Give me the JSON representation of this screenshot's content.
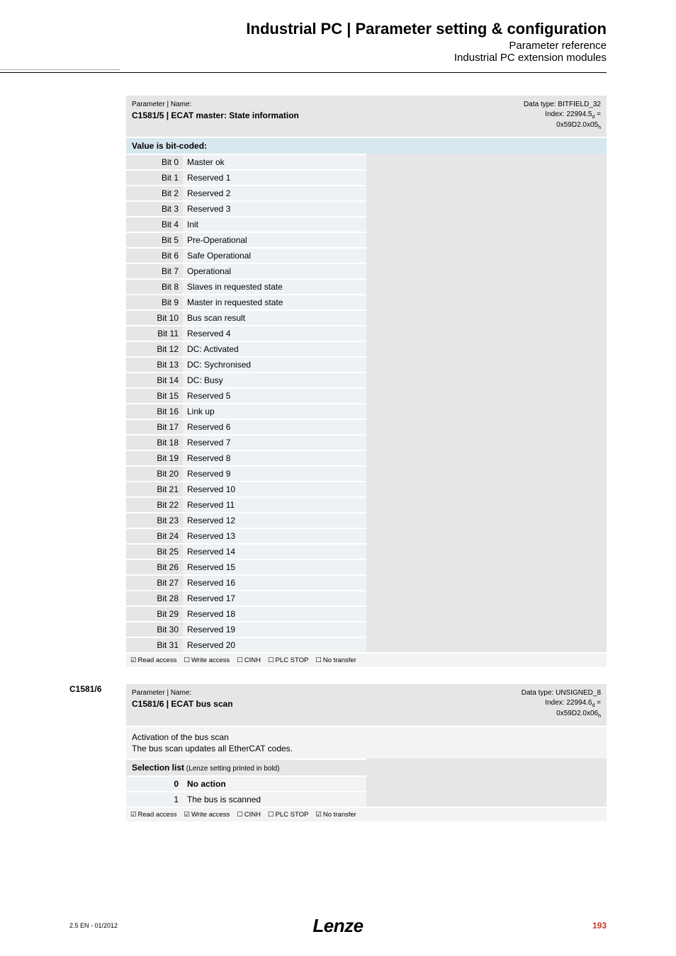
{
  "header": {
    "title": "Industrial PC | Parameter setting & configuration",
    "sub1": "Parameter reference",
    "sub2": "Industrial PC extension modules"
  },
  "param1": {
    "label": "Parameter | Name:",
    "name": "C1581/5 | ECAT master: State information",
    "datatype": "Data type: BITFIELD_32",
    "index_line": "Index: 22994.5",
    "index_sub": "d",
    "index_eq": " =",
    "hex": "0x59D2.0x05",
    "hex_sub": "h",
    "bitcoded_label": "Value is bit-coded:",
    "bits": [
      {
        "bit": "Bit 0",
        "desc": "Master ok"
      },
      {
        "bit": "Bit 1",
        "desc": "Reserved 1"
      },
      {
        "bit": "Bit 2",
        "desc": "Reserved 2"
      },
      {
        "bit": "Bit 3",
        "desc": "Reserved 3"
      },
      {
        "bit": "Bit 4",
        "desc": "Init"
      },
      {
        "bit": "Bit 5",
        "desc": "Pre-Operational"
      },
      {
        "bit": "Bit 6",
        "desc": "Safe Operational"
      },
      {
        "bit": "Bit 7",
        "desc": "Operational"
      },
      {
        "bit": "Bit 8",
        "desc": "Slaves in requested state"
      },
      {
        "bit": "Bit 9",
        "desc": "Master in requested state"
      },
      {
        "bit": "Bit 10",
        "desc": "Bus scan result"
      },
      {
        "bit": "Bit 11",
        "desc": "Reserved 4"
      },
      {
        "bit": "Bit 12",
        "desc": "DC: Activated"
      },
      {
        "bit": "Bit 13",
        "desc": "DC: Sychronised"
      },
      {
        "bit": "Bit 14",
        "desc": "DC: Busy"
      },
      {
        "bit": "Bit 15",
        "desc": "Reserved 5"
      },
      {
        "bit": "Bit 16",
        "desc": "Link up"
      },
      {
        "bit": "Bit 17",
        "desc": "Reserved 6"
      },
      {
        "bit": "Bit 18",
        "desc": "Reserved 7"
      },
      {
        "bit": "Bit 19",
        "desc": "Reserved 8"
      },
      {
        "bit": "Bit 20",
        "desc": "Reserved 9"
      },
      {
        "bit": "Bit 21",
        "desc": "Reserved 10"
      },
      {
        "bit": "Bit 22",
        "desc": "Reserved 11"
      },
      {
        "bit": "Bit 23",
        "desc": "Reserved 12"
      },
      {
        "bit": "Bit 24",
        "desc": "Reserved 13"
      },
      {
        "bit": "Bit 25",
        "desc": "Reserved 14"
      },
      {
        "bit": "Bit 26",
        "desc": "Reserved 15"
      },
      {
        "bit": "Bit 27",
        "desc": "Reserved 16"
      },
      {
        "bit": "Bit 28",
        "desc": "Reserved 17"
      },
      {
        "bit": "Bit 29",
        "desc": "Reserved 18"
      },
      {
        "bit": "Bit 30",
        "desc": "Reserved 19"
      },
      {
        "bit": "Bit 31",
        "desc": "Reserved 20"
      }
    ],
    "access": {
      "read": "Read access",
      "write": "Write access",
      "cinh": "CINH",
      "plc": "PLC STOP",
      "notransfer": "No transfer"
    }
  },
  "section2_id": "C1581/6",
  "param2": {
    "label": "Parameter | Name:",
    "name": "C1581/6 | ECAT bus scan",
    "datatype": "Data type: UNSIGNED_8",
    "index_line": "Index: 22994.6",
    "index_sub": "d",
    "index_eq": " =",
    "hex": "0x59D2.0x06",
    "hex_sub": "h",
    "desc_l1": "Activation of the bus scan",
    "desc_l2": "The bus scan updates all EtherCAT codes.",
    "sel_header": "Selection list",
    "sel_hint": " (Lenze setting printed in bold)",
    "rows": [
      {
        "v": "0",
        "t": "No action",
        "bold": true
      },
      {
        "v": "1",
        "t": "The bus is scanned",
        "bold": false
      }
    ],
    "access": {
      "read": "Read access",
      "write": "Write access",
      "cinh": "CINH",
      "plc": "PLC STOP",
      "notransfer": "No transfer"
    }
  },
  "footer": {
    "left": "2.5 EN - 01/2012",
    "center": "Lenze",
    "right": "193"
  },
  "cb_checked": "☑",
  "cb_unchecked": "☐"
}
